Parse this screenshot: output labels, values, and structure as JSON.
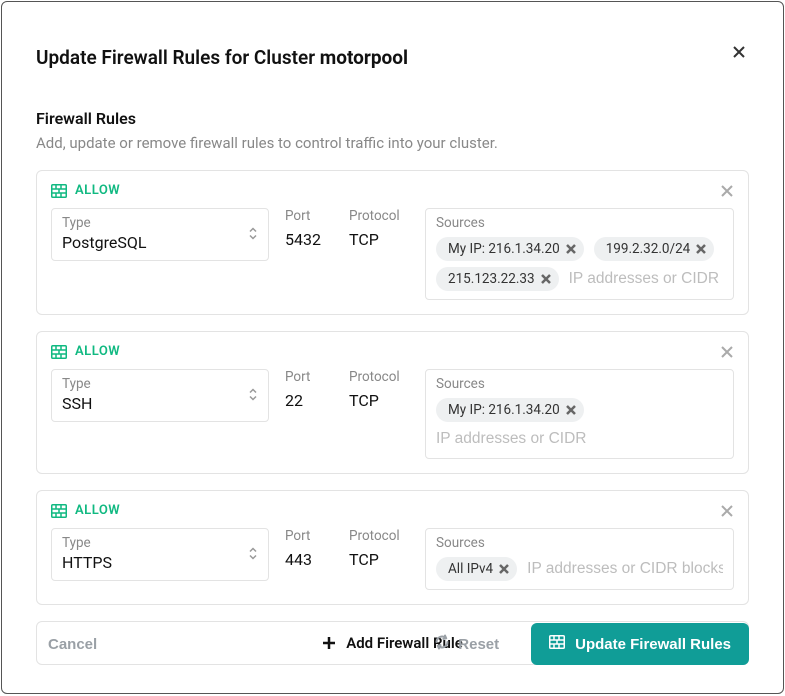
{
  "dialog": {
    "title_prefix": "Update Firewall Rules for Cluster",
    "cluster_name": "motorpool"
  },
  "section": {
    "heading": "Firewall Rules",
    "description": "Add, update or remove firewall rules to control traffic into your cluster."
  },
  "labels": {
    "allow": "ALLOW",
    "type": "Type",
    "port": "Port",
    "protocol": "Protocol",
    "sources": "Sources",
    "sources_placeholder_short": "IP addresses or CIDR bloc",
    "sources_placeholder_med": "IP addresses or CIDR",
    "sources_placeholder_full": "IP addresses or CIDR blocks"
  },
  "rules": [
    {
      "type": "PostgreSQL",
      "port": "5432",
      "protocol": "TCP",
      "sources": [
        "My IP: 216.1.34.20",
        "199.2.32.0/24",
        "215.123.22.33"
      ],
      "placeholder_key": "sources_placeholder_short"
    },
    {
      "type": "SSH",
      "port": "22",
      "protocol": "TCP",
      "sources": [
        "My IP: 216.1.34.20"
      ],
      "placeholder_key": "sources_placeholder_med"
    },
    {
      "type": "HTTPS",
      "port": "443",
      "protocol": "TCP",
      "sources": [
        "All IPv4"
      ],
      "placeholder_key": "sources_placeholder_full"
    }
  ],
  "buttons": {
    "add_rule": "Add Firewall Rule",
    "cancel": "Cancel",
    "reset": "Reset",
    "submit": "Update Firewall Rules"
  },
  "colors": {
    "accent_teal": "#109d97",
    "allow_green": "#10b981"
  }
}
